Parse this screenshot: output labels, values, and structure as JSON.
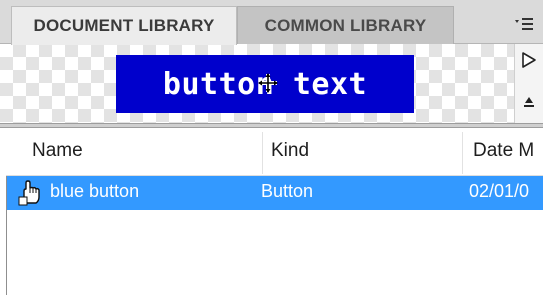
{
  "tabs": [
    {
      "label": "DOCUMENT LIBRARY",
      "active": true
    },
    {
      "label": "COMMON LIBRARY",
      "active": false
    }
  ],
  "panel_menu_icon": "panel-menu-icon",
  "preview": {
    "button_text": "button text",
    "button_color": "#0000cc",
    "play_icon": "play-icon",
    "stop_icon": "stop-icon",
    "cursor_icon": "move-cursor-icon"
  },
  "columns": [
    "Name",
    "Kind",
    "Date M"
  ],
  "rows": [
    {
      "name": "blue button",
      "kind": "Button",
      "date": "02/01/0",
      "icon": "button-symbol-icon",
      "selected": true
    }
  ],
  "colors": {
    "selection": "#3399ff",
    "tab_bg": "#dadada"
  }
}
